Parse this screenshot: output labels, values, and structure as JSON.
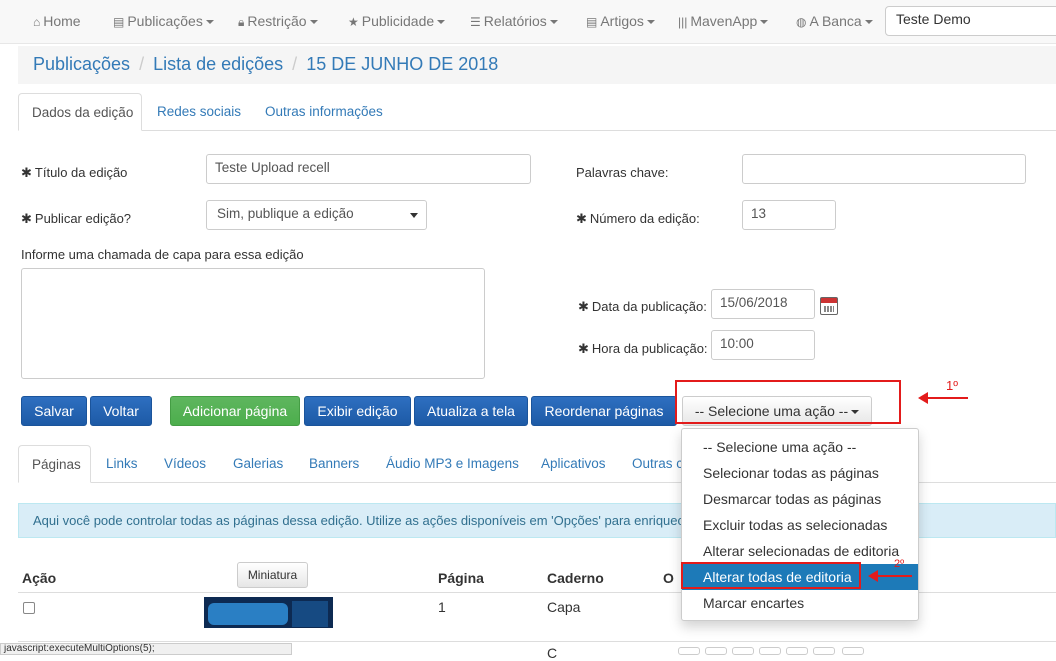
{
  "navbar": {
    "items": [
      {
        "icon": "home-icon",
        "label": "Home",
        "dropdown": false
      },
      {
        "icon": "file-icon",
        "label": "Publicações",
        "dropdown": true
      },
      {
        "icon": "lock-icon",
        "label": "Restrição",
        "dropdown": true
      },
      {
        "icon": "star-icon",
        "label": "Publicidade",
        "dropdown": true
      },
      {
        "icon": "list-icon",
        "label": "Relatórios",
        "dropdown": true
      },
      {
        "icon": "file-icon",
        "label": "Artigos",
        "dropdown": true
      },
      {
        "icon": "barcode-icon",
        "label": "MavenApp",
        "dropdown": true
      },
      {
        "icon": "globe-icon",
        "label": "A Banca",
        "dropdown": true
      }
    ],
    "user_value": "Teste Demo"
  },
  "breadcrumb": [
    "Publicações",
    "Lista de edições",
    "15 DE JUNHO DE 2018"
  ],
  "edition_tabs": [
    "Dados da edição",
    "Redes sociais",
    "Outras informações"
  ],
  "form": {
    "titulo_label": "Título da edição",
    "titulo_value": "Teste Upload recell",
    "publicar_label": "Publicar edição?",
    "publicar_value": "Sim, publique a edição",
    "chamada_label": "Informe uma chamada de capa para essa edição",
    "chamada_value": "",
    "palavras_label": "Palavras chave:",
    "palavras_value": "",
    "numero_label": "Número da edição:",
    "numero_value": "13",
    "data_label": "Data da publicação:",
    "data_value": "15/06/2018",
    "hora_label": "Hora da publicação:",
    "hora_value": "10:00"
  },
  "buttons": {
    "salvar": "Salvar",
    "voltar": "Voltar",
    "adicionar": "Adicionar página",
    "exibir": "Exibir edição",
    "atualiza": "Atualiza a tela",
    "reordenar": "Reordenar páginas",
    "acao": "-- Selecione uma ação --"
  },
  "annotations": {
    "first": "1º",
    "second": "2º"
  },
  "action_menu": [
    "-- Selecione uma ação --",
    "Selecionar todas as páginas",
    "Desmarcar todas as páginas",
    "Excluir todas as selecionadas",
    "Alterar selecionadas de editoria",
    "Alterar todas de editoria",
    "Marcar encartes"
  ],
  "content_tabs": [
    "Páginas",
    "Links",
    "Vídeos",
    "Galerias",
    "Banners",
    "Áudio MP3 e Imagens",
    "Aplicativos",
    "Outras c"
  ],
  "info_text": "Aqui você pode controlar todas as páginas dessa edição. Utilize as ações disponíveis em 'Opções' para enriquec",
  "table": {
    "headers": {
      "acao": "Ação",
      "miniatura": "Miniatura",
      "pagina": "Página",
      "caderno": "Caderno",
      "opcoes": "O"
    },
    "rows": [
      {
        "pagina": "1",
        "caderno": "Capa"
      },
      {
        "pagina": "",
        "caderno": "C"
      }
    ]
  },
  "status_bar": "javascript:executeMultiOptions(5);",
  "colors": {
    "link": "#337ab7",
    "primary": "#1d5aa6",
    "success": "#4cae4c",
    "highlight": "#1d7ab8",
    "annotation": "#e31b1b"
  }
}
